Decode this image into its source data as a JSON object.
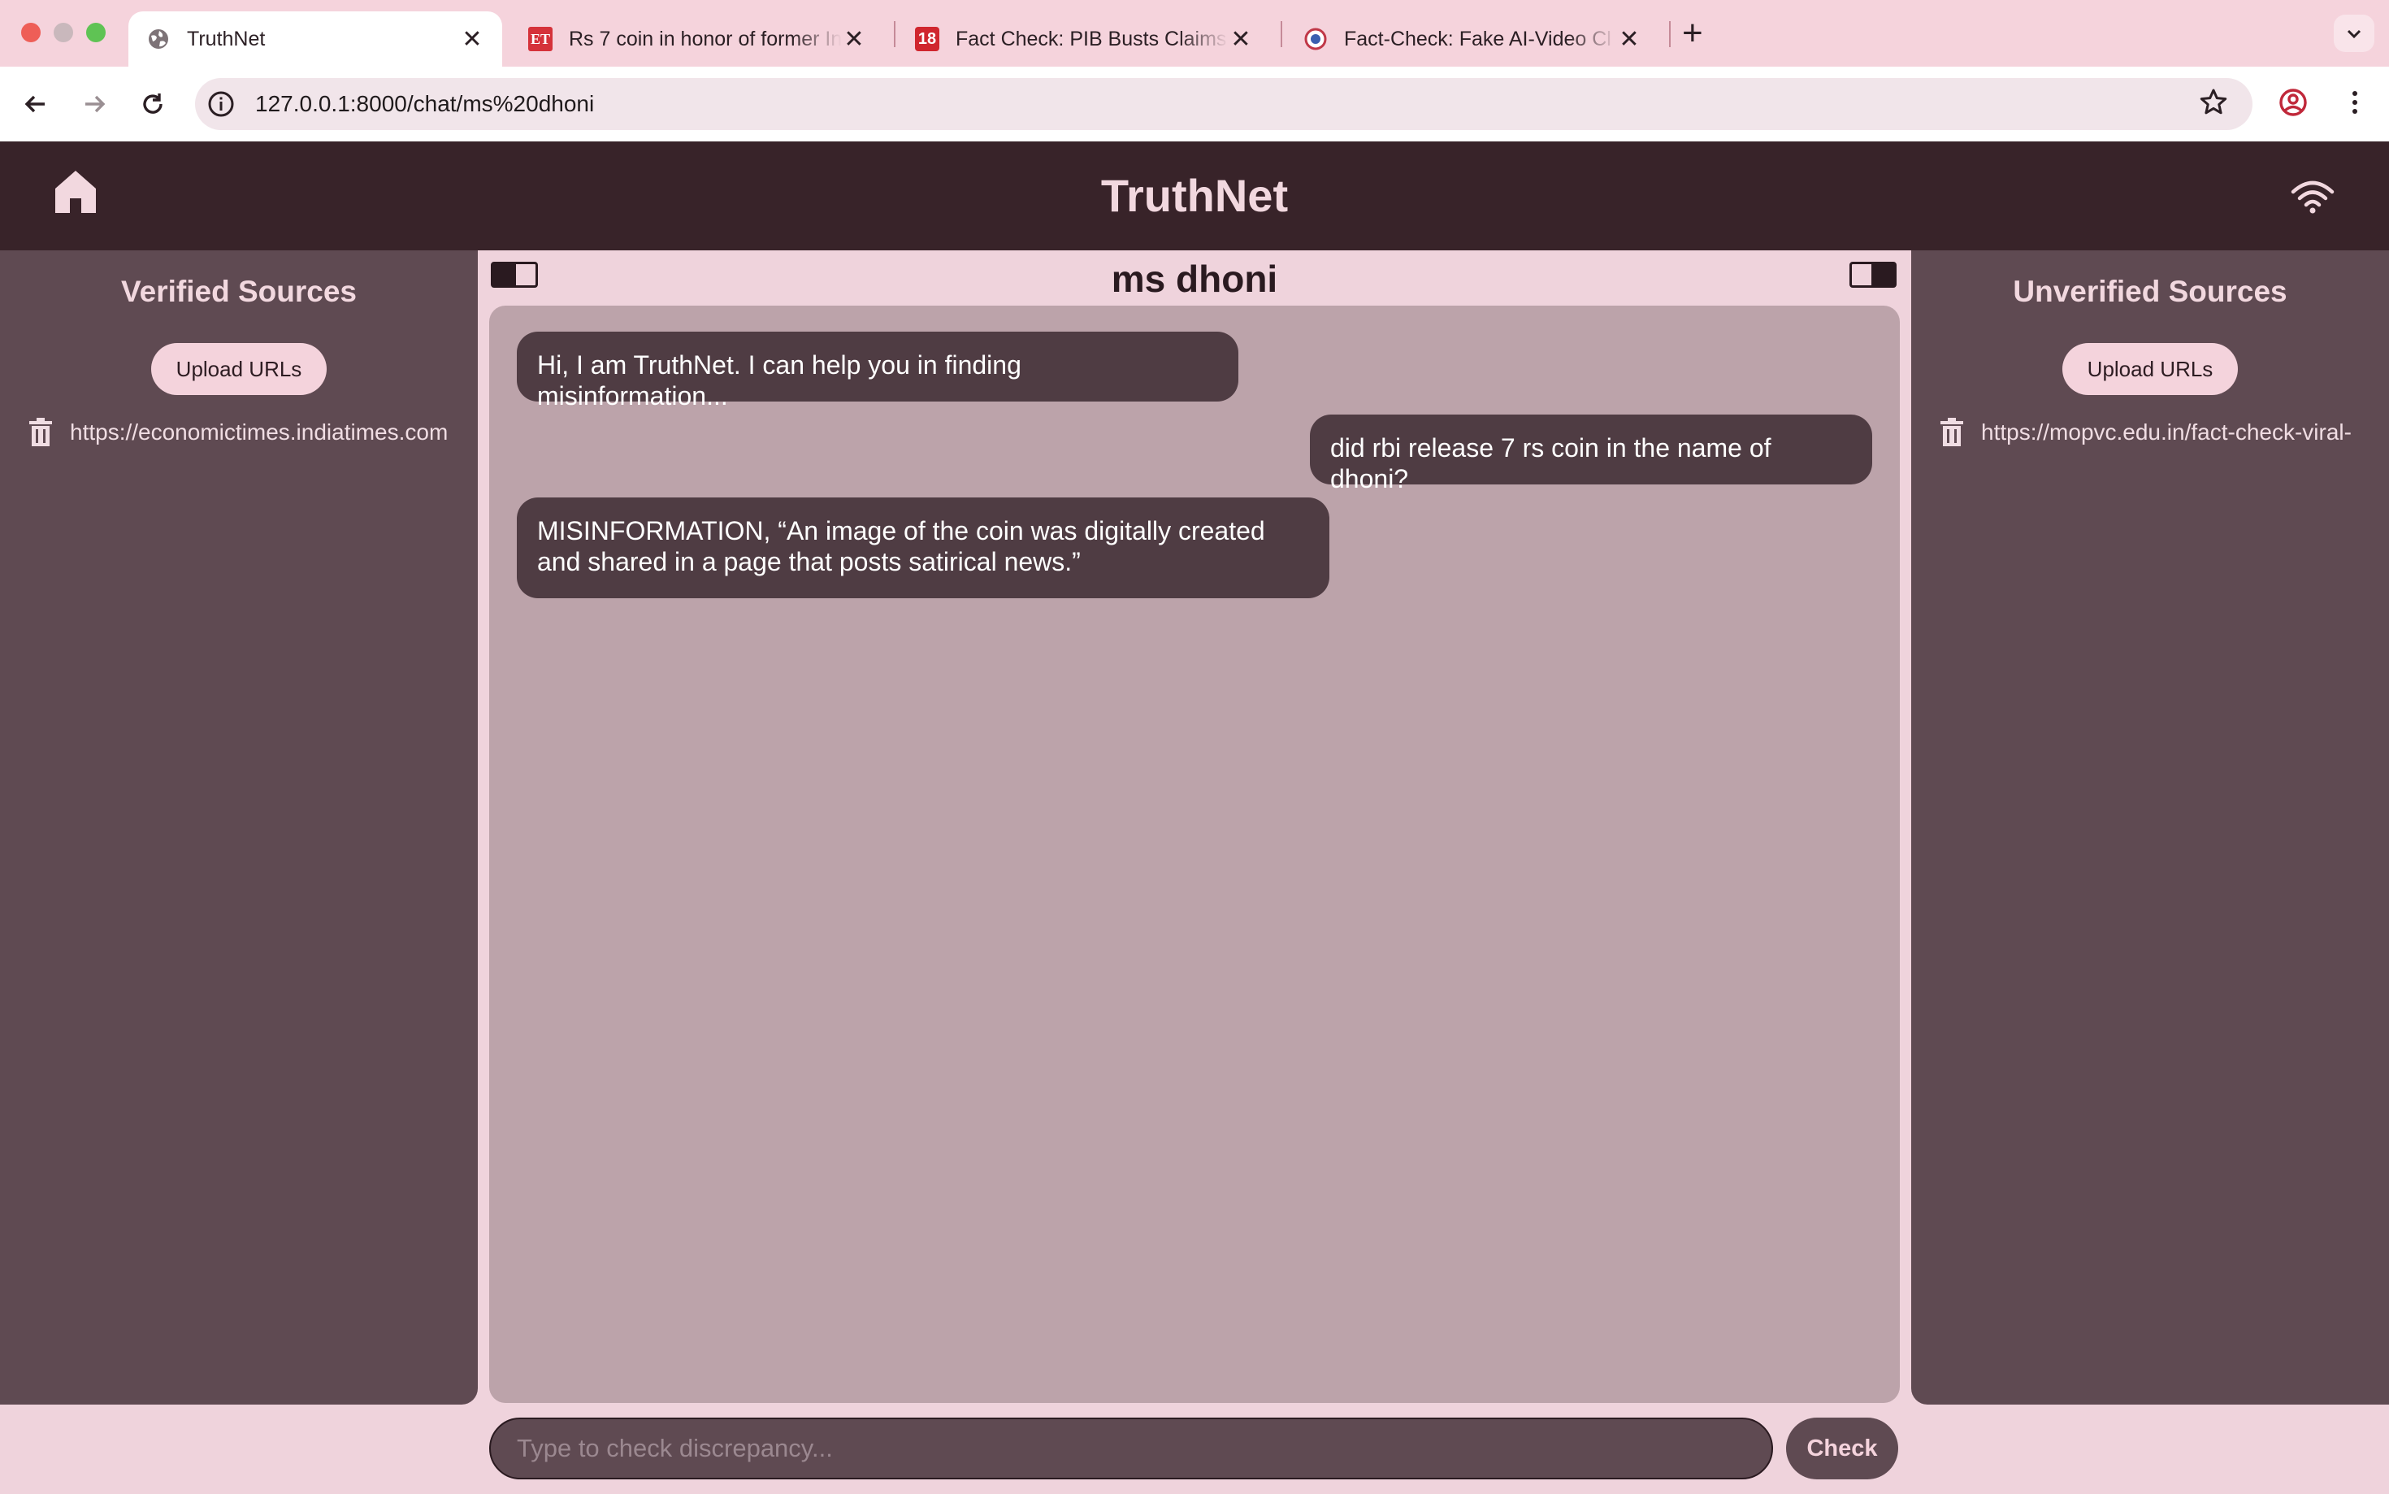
{
  "browser": {
    "tabs": [
      {
        "title": "TruthNet",
        "active": true,
        "favicon": "globe-icon"
      },
      {
        "title": "Rs 7 coin in honor of former Ind",
        "active": false,
        "favicon": "et-logo-icon"
      },
      {
        "title": "Fact Check: PIB Busts Claims",
        "active": false,
        "favicon": "news18-logo-icon"
      },
      {
        "title": "Fact-Check: Fake AI-Video Cl",
        "active": false,
        "favicon": "seal-icon"
      }
    ],
    "url": "127.0.0.1:8000/chat/ms%20dhoni",
    "favicon_labels": {
      "et": "ET",
      "n18": "18"
    }
  },
  "header": {
    "title": "TruthNet",
    "home_icon": "home-icon",
    "status_icon": "wifi-icon"
  },
  "verified": {
    "title": "Verified Sources",
    "upload_label": "Upload URLs",
    "sources": [
      "https://economictimes.indiatimes.com"
    ]
  },
  "unverified": {
    "title": "Unverified Sources",
    "upload_label": "Upload URLs",
    "sources": [
      "https://mopvc.edu.in/fact-check-viral-"
    ]
  },
  "chat": {
    "title": "ms dhoni",
    "messages": [
      {
        "sender": "bot",
        "text": "Hi, I am TruthNet. I can help you in finding misinformation..."
      },
      {
        "sender": "user",
        "text": "did rbi release 7 rs coin in the name of dhoni?"
      },
      {
        "sender": "bot",
        "text": "MISINFORMATION, “An image of the coin was digitally created and shared in a page that posts satirical news.”"
      }
    ],
    "input_placeholder": "Type to check discrepancy...",
    "input_value": "",
    "check_label": "Check"
  },
  "colors": {
    "header_bg": "#382329",
    "panel_bg": "#5f4a52",
    "chat_bg": "#bca3aa",
    "bubble_bg": "#4f3c43",
    "page_bg": "#efd3dc",
    "accent_light": "#f4d3dc"
  }
}
